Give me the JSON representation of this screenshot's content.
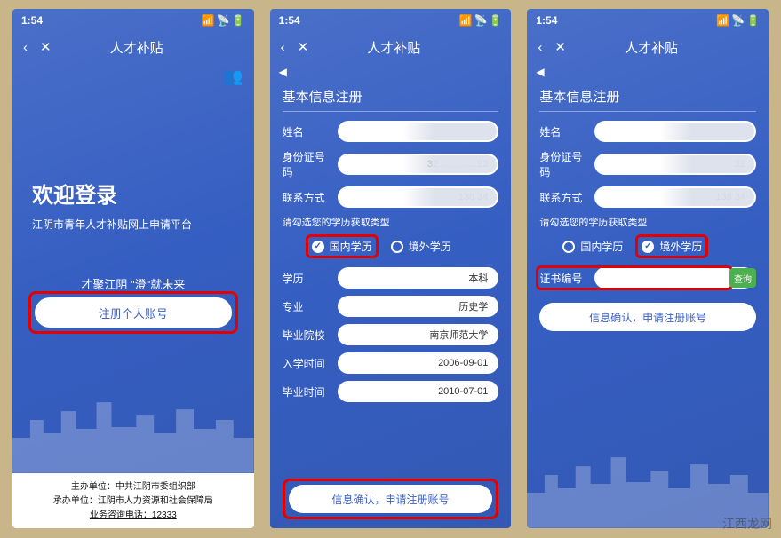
{
  "status": {
    "time": "1:54",
    "signal_icon": "signal",
    "wifi_icon": "wifi",
    "battery_icon": "battery"
  },
  "nav": {
    "back": "‹",
    "close": "✕",
    "title": "人才补贴"
  },
  "screen1": {
    "friends_icon": "friends",
    "welcome_title": "欢迎登录",
    "welcome_sub": "江阴市青年人才补贴网上申请平台",
    "slogan": "才聚江阴  \"澄\"就未来",
    "register_btn": "注册个人账号",
    "footer_line1_label": "主办单位：",
    "footer_line1_value": "中共江阴市委组织部",
    "footer_line2_label": "承办单位：",
    "footer_line2_value": "江阴市人力资源和社会保障局",
    "footer_line3_label": "业务咨询电话：",
    "footer_line3_value": "12333"
  },
  "screen2": {
    "section_title": "基本信息注册",
    "name_label": "姓名",
    "name_value": "",
    "id_label": "身份证号码",
    "id_value": "32…………23",
    "phone_label": "联系方式",
    "phone_value": "138        34",
    "prompt": "请勾选您的学历获取类型",
    "radio_domestic": "国内学历",
    "radio_overseas": "境外学历",
    "edu_level_label": "学历",
    "edu_level_value": "本科",
    "major_label": "专业",
    "major_value": "历史学",
    "school_label": "毕业院校",
    "school_value": "南京师范大学",
    "enroll_label": "入学时间",
    "enroll_value": "2006-09-01",
    "grad_label": "毕业时间",
    "grad_value": "2010-07-01",
    "confirm_btn": "信息确认，申请注册账号"
  },
  "screen3": {
    "section_title": "基本信息注册",
    "name_label": "姓名",
    "name_value": "",
    "id_label": "身份证号码",
    "id_value": "32",
    "phone_label": "联系方式",
    "phone_value": "138        34",
    "prompt": "请勾选您的学历获取类型",
    "radio_domestic": "国内学历",
    "radio_overseas": "境外学历",
    "cert_label": "证书编号",
    "cert_value": "",
    "query_btn": "查询",
    "confirm_btn": "信息确认，申请注册账号"
  },
  "watermark": "江西龙网"
}
